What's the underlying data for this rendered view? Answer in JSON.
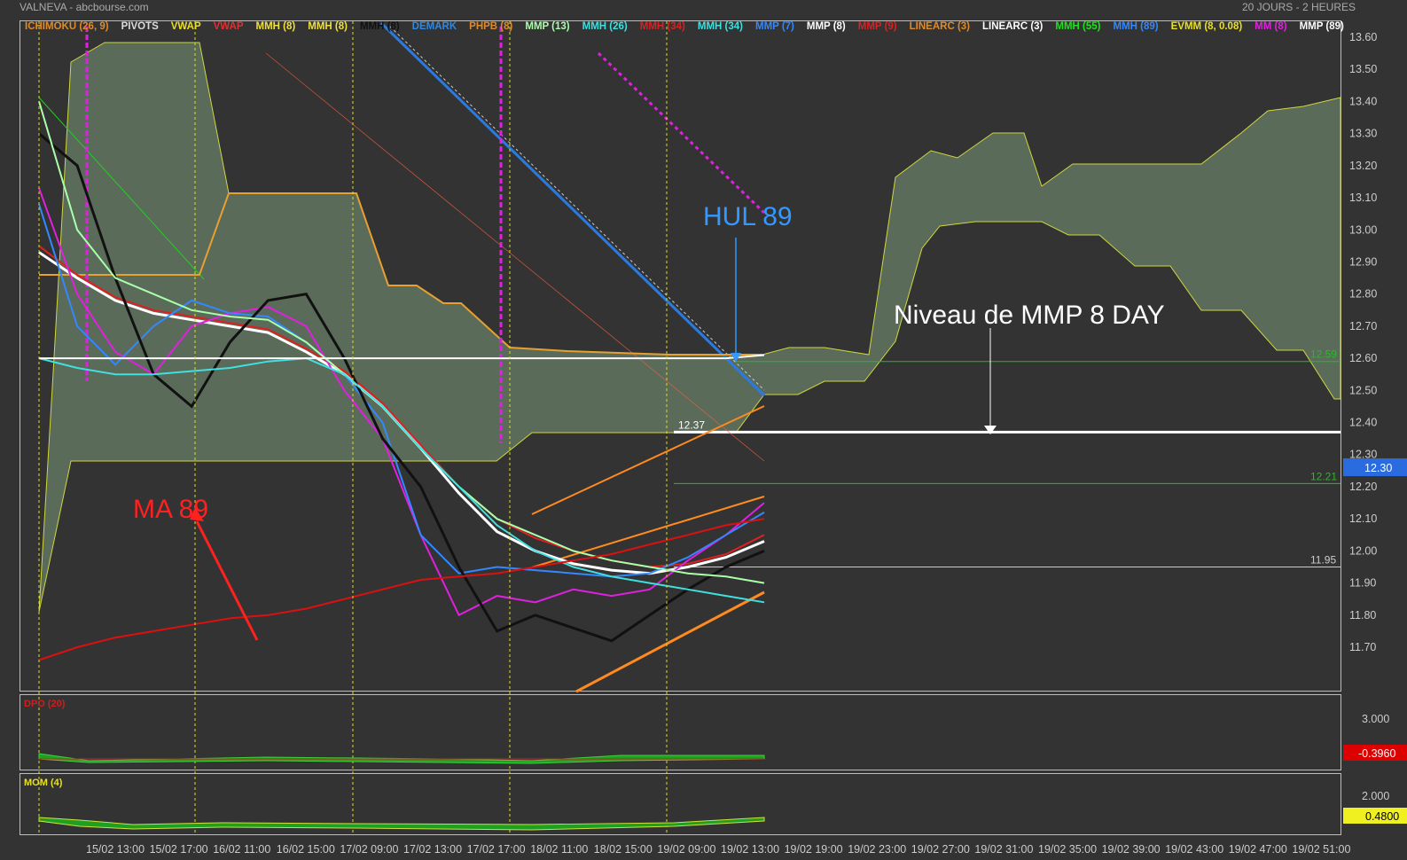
{
  "header": {
    "title": "VALNEVA - abcbourse.com",
    "period": "20 JOURS - 2 HEURES"
  },
  "legend": [
    {
      "label": "ICHIMOKU (26, 9)",
      "color": "#e08a2a"
    },
    {
      "label": "PIVOTS",
      "color": "#dddddd"
    },
    {
      "label": "VWAP",
      "color": "#e8e020"
    },
    {
      "label": "VWAP",
      "color": "#e03030"
    },
    {
      "label": "MMH (8)",
      "color": "#f0e040"
    },
    {
      "label": "MMH (8)",
      "color": "#f0e040"
    },
    {
      "label": "MMH (8)",
      "color": "#111111"
    },
    {
      "label": "DEMARK",
      "color": "#3388dd"
    },
    {
      "label": "PHPB (8)",
      "color": "#e08a2a"
    },
    {
      "label": "MMP (13)",
      "color": "#aaffaa"
    },
    {
      "label": "MMH (26)",
      "color": "#40e0e0"
    },
    {
      "label": "MMH (34)",
      "color": "#dd2020"
    },
    {
      "label": "MMH (34)",
      "color": "#40e0e0"
    },
    {
      "label": "MMP (7)",
      "color": "#3388ff"
    },
    {
      "label": "MMP (8)",
      "color": "#ffffff"
    },
    {
      "label": "MMP (9)",
      "color": "#dd2020"
    },
    {
      "label": "LINEARC (3)",
      "color": "#e08a2a"
    },
    {
      "label": "LINEARC (3)",
      "color": "#ffffff"
    },
    {
      "label": "MMH (55)",
      "color": "#20e020"
    },
    {
      "label": "MMH (89)",
      "color": "#3388ff"
    },
    {
      "label": "EVMM (8, 0.08)",
      "color": "#e8e020"
    },
    {
      "label": "MM (8)",
      "color": "#e020e0"
    },
    {
      "label": "MMP (89)",
      "color": "#ffffff"
    }
  ],
  "chart_data": [
    {
      "type": "line",
      "title": "VALNEVA",
      "y_ticks": [
        "13.60",
        "13.50",
        "13.40",
        "13.30",
        "13.20",
        "13.10",
        "13.00",
        "12.90",
        "12.80",
        "12.70",
        "12.60",
        "12.50",
        "12.40",
        "12.30",
        "12.20",
        "12.10",
        "12.00",
        "11.90",
        "11.80",
        "11.70"
      ],
      "ylim": [
        11.62,
        13.63
      ],
      "x_ticks": [
        "15/02 13:00",
        "15/02 17:00",
        "16/02 11:00",
        "16/02 15:00",
        "17/02 09:00",
        "17/02 13:00",
        "17/02 17:00",
        "18/02 11:00",
        "18/02 15:00",
        "19/02 09:00",
        "19/02 13:00",
        "19/02 19:00",
        "19/02 23:00",
        "19/02 27:00",
        "19/02 31:00",
        "19/02 35:00",
        "19/02 39:00",
        "19/02 43:00",
        "19/02 47:00",
        "19/02 51:00"
      ],
      "last_price": "12.30",
      "levels": [
        {
          "label": "12.59",
          "value": 12.59,
          "color": "#20c020"
        },
        {
          "label": "12.37",
          "value": 12.37,
          "color": "#ffffff"
        },
        {
          "label": "12.21",
          "value": 12.21,
          "color": "#20c020"
        },
        {
          "label": "11.95",
          "value": 11.95,
          "color": "#cccccc"
        }
      ],
      "series": [
        {
          "name": "MMP (8)",
          "color": "#ffffff",
          "values": [
            12.93,
            12.85,
            12.78,
            12.74,
            12.72,
            12.7,
            12.68,
            12.62,
            12.55,
            12.45,
            12.32,
            12.18,
            12.06,
            12.0,
            11.96,
            11.94,
            11.93,
            11.95,
            11.98,
            12.03
          ]
        },
        {
          "name": "MMP (9)",
          "color": "#dd2020",
          "values": [
            12.95,
            12.86,
            12.79,
            12.75,
            12.73,
            12.71,
            12.69,
            12.63,
            12.56,
            12.46,
            12.33,
            12.2,
            12.1,
            12.04,
            12.0,
            11.97,
            11.95,
            11.96,
            11.99,
            12.05
          ]
        },
        {
          "name": "MM (8)",
          "color": "#e020e0",
          "values": [
            13.13,
            12.8,
            12.62,
            12.55,
            12.7,
            12.74,
            12.76,
            12.7,
            12.5,
            12.35,
            12.05,
            11.8,
            11.86,
            11.84,
            11.88,
            11.86,
            11.88,
            11.97,
            12.05,
            12.15
          ]
        },
        {
          "name": "MMP (7)",
          "color": "#3388ff",
          "values": [
            13.08,
            12.7,
            12.58,
            12.7,
            12.78,
            12.74,
            12.73,
            12.65,
            12.55,
            12.4,
            12.05,
            11.93,
            11.95,
            11.94,
            11.93,
            11.92,
            11.93,
            11.98,
            12.05,
            12.12
          ]
        },
        {
          "name": "MMH (8)",
          "color": "#111111",
          "values": [
            13.3,
            13.2,
            12.85,
            12.55,
            12.45,
            12.65,
            12.78,
            12.8,
            12.6,
            12.35,
            12.2,
            11.95,
            11.75,
            11.8,
            11.76,
            11.72,
            11.8,
            11.88,
            11.95,
            12.0
          ]
        },
        {
          "name": "MMH (55)",
          "color": "#aaffaa",
          "values": [
            13.4,
            13.0,
            12.85,
            12.8,
            12.75,
            12.73,
            12.72,
            12.65,
            12.55,
            12.45,
            12.32,
            12.2,
            12.1,
            12.05,
            12.0,
            11.97,
            11.95,
            11.93,
            11.92,
            11.9
          ]
        },
        {
          "name": "MMH (34)",
          "color": "#40e0e0",
          "values": [
            12.6,
            12.57,
            12.55,
            12.55,
            12.56,
            12.57,
            12.59,
            12.6,
            12.55,
            12.45,
            12.32,
            12.2,
            12.08,
            12.0,
            11.95,
            11.92,
            11.9,
            11.88,
            11.86,
            11.84
          ]
        },
        {
          "name": "MMP (89)",
          "color": "#ffffff",
          "values": [
            12.6,
            12.6,
            12.6,
            12.6,
            12.6,
            12.6,
            12.6,
            12.6,
            12.6,
            12.6,
            12.6,
            12.6,
            12.6,
            12.6,
            12.6,
            12.6,
            12.6,
            12.6,
            12.6,
            12.61
          ]
        },
        {
          "name": "MA 89",
          "color": "#dd1010",
          "values": [
            11.66,
            11.7,
            11.73,
            11.75,
            11.77,
            11.79,
            11.8,
            11.82,
            11.85,
            11.88,
            11.91,
            11.92,
            11.93,
            11.95,
            11.97,
            11.99,
            12.02,
            12.05,
            12.08,
            12.1
          ]
        }
      ],
      "annotations": [
        {
          "text": "HUL 89",
          "color": "#3399ff"
        },
        {
          "text": "MA 89",
          "color": "#ff2020"
        },
        {
          "text": "Niveau de MMP 8 DAY",
          "color": "#ffffff"
        }
      ]
    },
    {
      "type": "area",
      "title": "DPO (20)",
      "y_ticks": [
        "3.000"
      ],
      "last_value": "-0.3960"
    },
    {
      "type": "area",
      "title": "MOM (4)",
      "y_ticks": [
        "2.000"
      ],
      "last_value": "0.4800"
    }
  ]
}
